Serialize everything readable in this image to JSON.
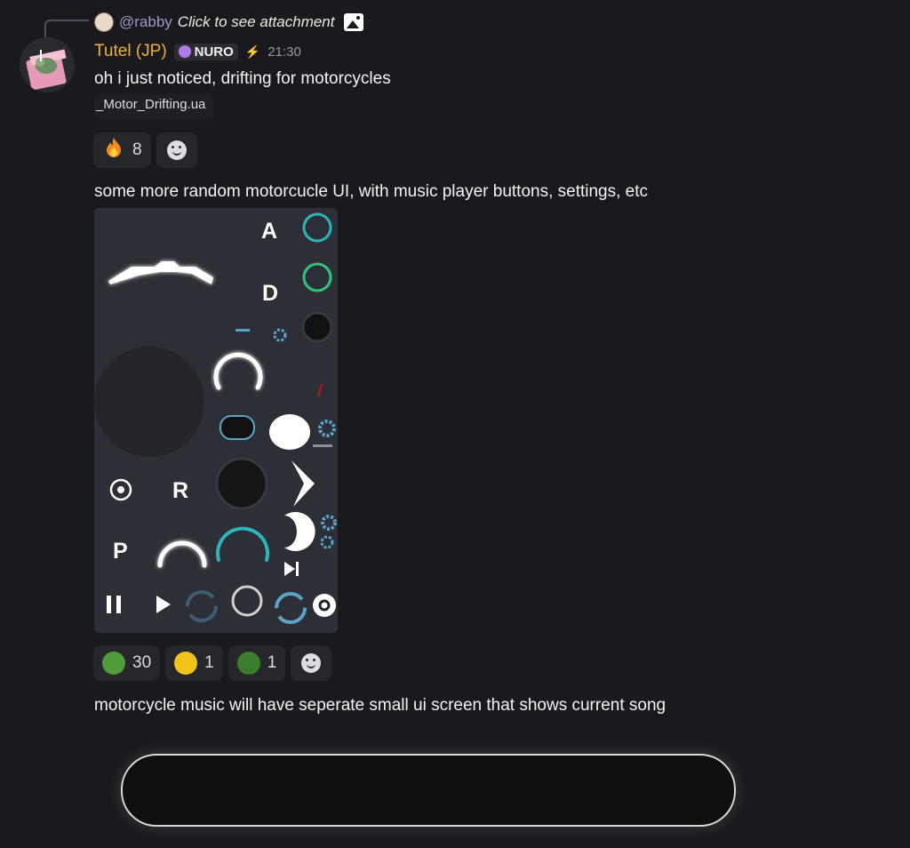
{
  "reply": {
    "username": "@rabby",
    "preview": "Click to see attachment",
    "attachment_icon": "image-icon"
  },
  "message": {
    "author": "Tutel (JP)",
    "badge": "NURO",
    "timestamp": "21:30",
    "lines": [
      "oh i just noticed, drifting for motorcycles",
      "some more random motorcucle UI, with music player buttons, settings, etc",
      "motorcycle music will have seperate small ui screen that shows current song"
    ],
    "file_name": "_Motor_Drifting.ua"
  },
  "reactions_1": [
    {
      "emoji": "fire",
      "count": "8"
    }
  ],
  "reactions_2": [
    {
      "emoji": "pepe-frog",
      "count": "30"
    },
    {
      "emoji": "awesome-face",
      "count": "1"
    },
    {
      "emoji": "duck",
      "count": "1"
    }
  ],
  "attachment": {
    "letters": {
      "a": "A",
      "d": "D",
      "r": "R",
      "p": "P"
    },
    "colors": {
      "teal": "#2eb5b8",
      "green": "#2fc57a",
      "blue": "#5ba3c8",
      "red": "#8e1f22"
    }
  },
  "colors": {
    "background": "#1a1a1e",
    "username": "#f0b232",
    "reply_username": "#9b9bc9"
  }
}
